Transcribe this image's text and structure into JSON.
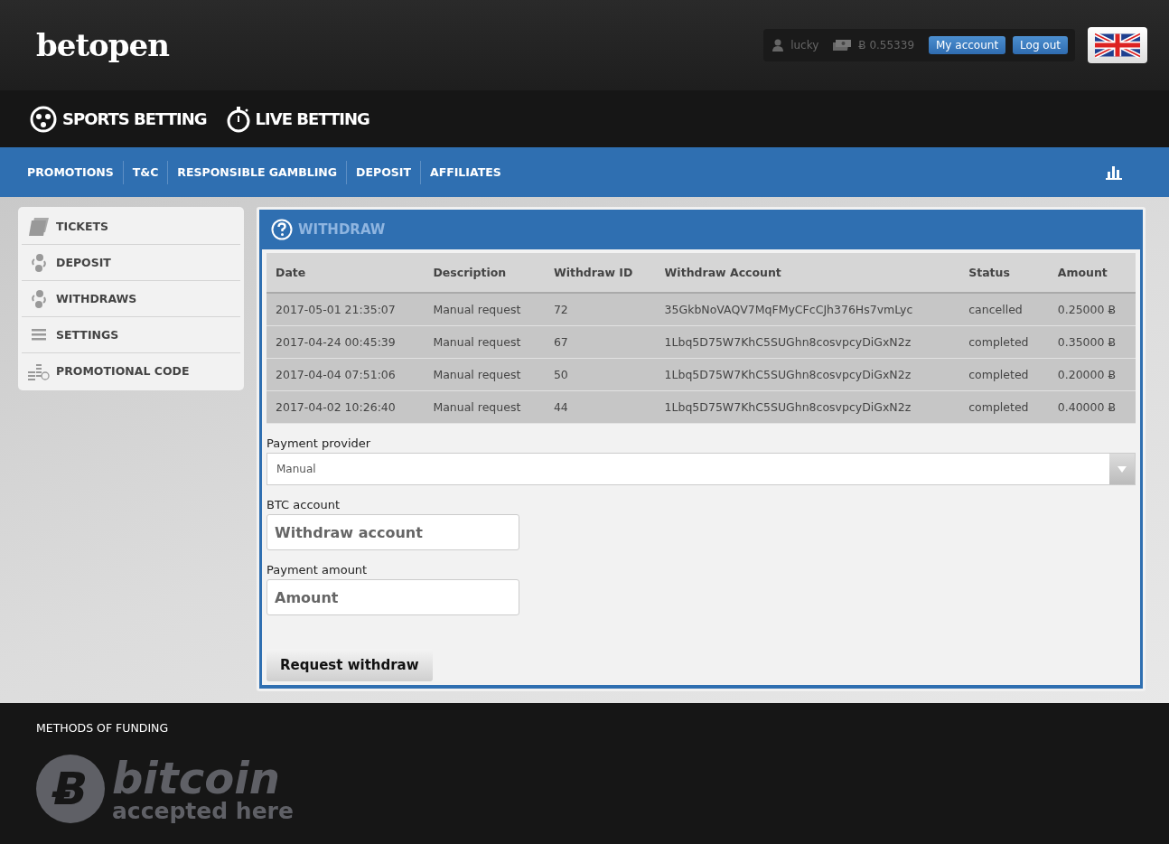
{
  "header": {
    "logo": "betopen",
    "user": "lucky",
    "balance": "Ƀ 0.55339",
    "buttons": [
      "My account",
      "Log out"
    ]
  },
  "main_nav": [
    {
      "label": "SPORTS BETTING",
      "kind": "ball"
    },
    {
      "label": "LIVE BETTING",
      "kind": "stopwatch"
    }
  ],
  "sub_nav": [
    "PROMOTIONS",
    "T&C",
    "RESPONSIBLE GAMBLING",
    "DEPOSIT",
    "AFFILIATES"
  ],
  "sidebar": {
    "items": [
      {
        "label": "TICKETS",
        "kind": "tickets"
      },
      {
        "label": "DEPOSIT",
        "kind": "exchange"
      },
      {
        "label": "WITHDRAWS",
        "kind": "exchange"
      },
      {
        "label": "SETTINGS",
        "kind": "menu"
      },
      {
        "label": "PROMOTIONAL CODE",
        "kind": "coins"
      }
    ]
  },
  "panel": {
    "title": "WITHDRAW",
    "table": {
      "columns": [
        "Date",
        "Description",
        "Withdraw ID",
        "Withdraw Account",
        "Status",
        "Amount"
      ],
      "rows": [
        [
          "2017-05-01 21:35:07",
          "Manual request",
          "72",
          "35GkbNoVAQV7MqFMyCFcCJh376Hs7vmLyc",
          "cancelled",
          "0.25000 Ƀ"
        ],
        [
          "2017-04-24 00:45:39",
          "Manual request",
          "67",
          "1Lbq5D75W7KhC5SUGhn8cosvpcyDiGxN2z",
          "completed",
          "0.35000 Ƀ"
        ],
        [
          "2017-04-04 07:51:06",
          "Manual request",
          "50",
          "1Lbq5D75W7KhC5SUGhn8cosvpcyDiGxN2z",
          "completed",
          "0.20000 Ƀ"
        ],
        [
          "2017-04-02 10:26:40",
          "Manual request",
          "44",
          "1Lbq5D75W7KhC5SUGhn8cosvpcyDiGxN2z",
          "completed",
          "0.40000 Ƀ"
        ]
      ]
    },
    "payment_provider": {
      "label": "Payment provider",
      "value": "Manual"
    },
    "btc_account": {
      "label": "BTC account",
      "placeholder": "Withdraw account"
    },
    "payment_amount": {
      "label": "Payment amount",
      "placeholder": "Amount"
    },
    "submit": "Request withdraw"
  },
  "footer": {
    "title": "METHODS OF FUNDING",
    "badge_symbol": "Ƀ",
    "badge_word": "bitcoin",
    "badge_tagline": "accepted here"
  }
}
